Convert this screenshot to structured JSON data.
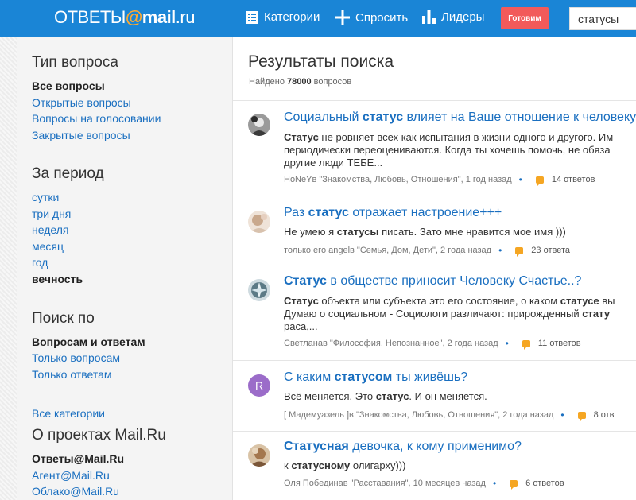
{
  "header": {
    "logo_prefix": "ОТВЕТЫ",
    "logo_at": "@",
    "logo_mail": "mail",
    "logo_suffix": ".ru",
    "nav": {
      "categories": "Категории",
      "ask": "Спросить",
      "leaders": "Лидеры"
    },
    "ready_button": "Готовим",
    "search_value": "статусы"
  },
  "sidebar": {
    "type_heading": "Тип вопроса",
    "type_items": [
      "Все вопросы",
      "Открытые вопросы",
      "Вопросы на голосовании",
      "Закрытые вопросы"
    ],
    "period_heading": "За период",
    "period_items": [
      "сутки",
      "три дня",
      "неделя",
      "месяц",
      "год",
      "вечность"
    ],
    "search_heading": "Поиск по",
    "search_items": [
      "Вопросам и ответам",
      "Только вопросам",
      "Только ответам"
    ],
    "all_categories": "Все категории",
    "projects_heading": "О проектах Mail.Ru",
    "project_items": [
      "Ответы@Mail.Ru",
      "Агент@Mail.Ru",
      "Облако@Mail.Ru"
    ]
  },
  "main": {
    "title": "Результаты поиска",
    "found_prefix": "Найдено ",
    "found_count": "78000",
    "found_suffix": " вопросов",
    "questions": [
      {
        "title_a": "Социальный ",
        "title_b": "статус",
        "title_c": " влияет на Ваше отношение к человеку?",
        "line1_a": "Статус",
        "line1_b": " не ровняет всех как испытания в жизни одного и другого. Им",
        "line2": "периодически переоцениваются. Когда ты хочешь помочь, не обяза",
        "line3": "другие люди ТЕБЕ...",
        "author": "HoNeY",
        "category": " в \"Знакомства, Любовь, Отношения\", 1 год назад",
        "answers": "14 ответов"
      },
      {
        "title_a": "Раз ",
        "title_b": "статус",
        "title_c": " отражает настроение+++",
        "line1_a": "Не умею я ",
        "line1_b": "статусы",
        "line1_c": " писать. Зато мне нравится мое имя )))",
        "author": "только его angel",
        "category": " в \"Семья, Дом, Дети\", 2 года назад",
        "answers": "23 ответа"
      },
      {
        "title_a": "",
        "title_b": "Статус",
        "title_c": " в обществе приносит Человеку Счастье..?",
        "line1_a": "Статус",
        "line1_b": " объекта или субъекта это его состояние, о каком ",
        "line1_c": "статусе",
        "line1_d": " вы",
        "line2_a": "Думаю о социальном - Социологи различают: прирожденный ",
        "line2_b": "стату",
        "line3": "раса,...",
        "author": "Светлана",
        "category": " в \"Философия, Непознанное\", 2 года назад",
        "answers": "11 ответов"
      },
      {
        "title_a": "С каким ",
        "title_b": "статусом",
        "title_c": " ты живёшь?",
        "line1_a": "Всё меняется. Это ",
        "line1_b": "статус",
        "line1_c": ". И он меняется.",
        "author": "[ Мадемуазель ]",
        "category": " в \"Знакомства, Любовь, Отношения\", 2 года назад",
        "answers": "8 отв",
        "avatar_letter": "R"
      },
      {
        "title_a": "",
        "title_b": "Статусная",
        "title_c": " девочка, к кому применимо?",
        "line1_a": "к ",
        "line1_b": "статусному",
        "line1_c": " олигарху)))",
        "author": "Оля Победина",
        "category": " в \"Расставания\", 10 месяцев назад",
        "answers": "6 ответов"
      }
    ]
  },
  "colors": {
    "header_blue": "#1a85d6",
    "link_blue": "#1a6fc0",
    "ready_red": "#f25a5a",
    "answer_orange": "#f5a623"
  }
}
